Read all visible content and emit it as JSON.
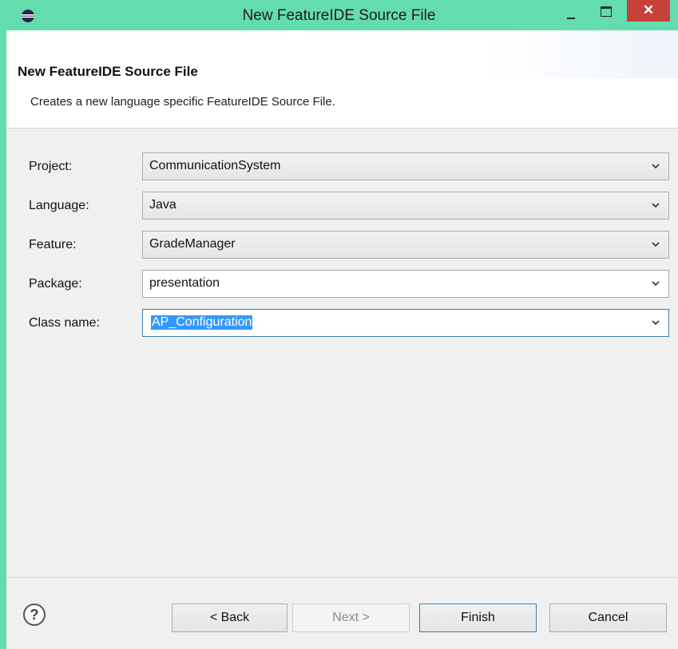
{
  "window": {
    "title": "New FeatureIDE Source File",
    "close_glyph": "✕",
    "colors": {
      "titlebar": "#63dcae",
      "close": "#c7413a",
      "selection": "#3399ff"
    }
  },
  "header": {
    "title": "New FeatureIDE Source File",
    "description": "Creates a new language specific FeatureIDE Source File."
  },
  "form": {
    "project": {
      "label": "Project:",
      "value": "CommunicationSystem"
    },
    "language": {
      "label": "Language:",
      "value": "Java"
    },
    "feature": {
      "label": "Feature:",
      "value": "GradeManager"
    },
    "package": {
      "label": "Package:",
      "value": "presentation"
    },
    "class_name": {
      "label": "Class name:",
      "value": "AP_Configuration"
    }
  },
  "footer": {
    "help_icon": "help-icon",
    "back_label": "< Back",
    "next_label": "Next >",
    "finish_label": "Finish",
    "cancel_label": "Cancel"
  }
}
